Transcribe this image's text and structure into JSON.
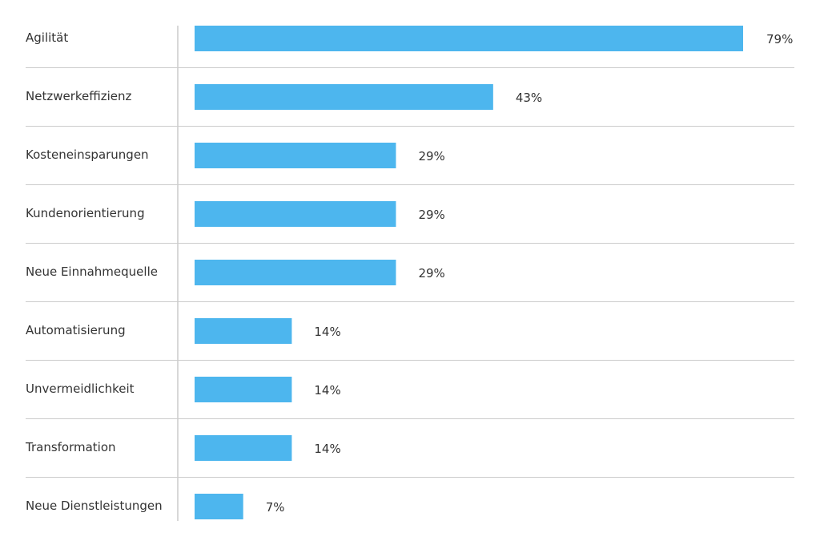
{
  "chart_data": {
    "type": "bar",
    "orientation": "horizontal",
    "title": "",
    "xlabel": "",
    "ylabel": "",
    "categories": [
      "Agilität",
      "Netzwerkeffizienz",
      "Kosteneinsparungen",
      "Kundenorientierung",
      "Neue Einnahmequelle",
      "Automatisierung",
      "Unvermeidlichkeit",
      "Transformation",
      "Neue Dienstleistungen"
    ],
    "values": [
      79,
      43,
      29,
      29,
      29,
      14,
      14,
      14,
      7
    ],
    "value_labels": [
      "79%",
      "43%",
      "29%",
      "29%",
      "29%",
      "14%",
      "14%",
      "14%",
      "7%"
    ],
    "unit": "%",
    "xlim": [
      0,
      79
    ],
    "grid": "horizontal row separators",
    "legend": "none",
    "bar_color": "#4db6ee",
    "grid_color": "#cccccc",
    "text_color": "#333333"
  }
}
